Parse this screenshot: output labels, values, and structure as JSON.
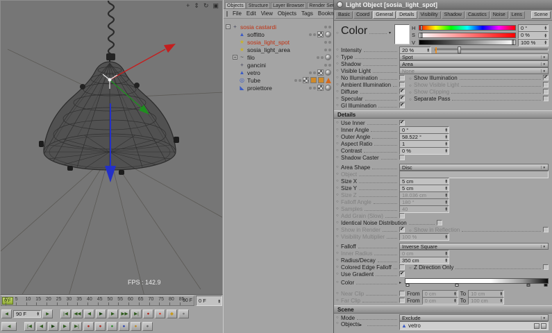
{
  "colors": {
    "ui_background": "#a6a6a6",
    "viewport_background": "#767676",
    "selection_red": "#c03010",
    "axis_x_red": "#c41e1e",
    "axis_y_green": "#1f8f1f",
    "axis_z_blue": "#2330c8",
    "timeline_green": "#93ad3a",
    "record_red": "#b02a1e"
  },
  "viewport": {
    "fps_label": "FPS : 142.9",
    "toolbar_icons": [
      "pan-icon",
      "zoom-icon",
      "rotate-icon",
      "maximize-icon"
    ]
  },
  "timeline": {
    "ticks": [
      "0",
      "5",
      "10",
      "15",
      "20",
      "25",
      "30",
      "35",
      "40",
      "45",
      "50",
      "55",
      "60",
      "65",
      "70",
      "75",
      "80",
      "85"
    ],
    "end_label": "90 F",
    "playhead_label": "0 F",
    "frame_field": "90 F",
    "current_field": "0 F",
    "transport_row1": [
      "goto-start",
      "prev-key",
      "prev-frame",
      "play",
      "next-frame",
      "next-key",
      "goto-end",
      "record",
      "record-active",
      "key",
      "autokey"
    ],
    "transport_row2": [
      "goto-start",
      "prev-frame",
      "play",
      "next-frame",
      "goto-end",
      "record",
      "record-position",
      "record-scale",
      "record-rotation",
      "record-parameter",
      "record-point-level"
    ]
  },
  "objects_panel": {
    "tabs": [
      "Objects",
      "Structure",
      "Layer Browser",
      "Render Settings"
    ],
    "active_tab": "Objects",
    "menu": [
      "File",
      "Edit",
      "View",
      "Objects",
      "Tags",
      "Bookmarks"
    ],
    "tree": [
      {
        "label": "sosia castardi",
        "level": 0,
        "icon": "null-icon",
        "expander": "-",
        "selected": true,
        "tags": []
      },
      {
        "label": "soffitto",
        "level": 1,
        "icon": "polygon-icon",
        "expander": "",
        "selected": false,
        "tags": [
          "texture-tag",
          "phong-tag"
        ]
      },
      {
        "label": "sosia_light_spot",
        "level": 1,
        "icon": "light-icon",
        "expander": "",
        "selected": true,
        "tags": []
      },
      {
        "label": "sosia_light_area",
        "level": 1,
        "icon": "light-icon",
        "expander": "",
        "selected": false,
        "tags": []
      },
      {
        "label": "filo",
        "level": 1,
        "icon": "spline-icon",
        "expander": "+",
        "selected": false,
        "tags": [
          "phong-tag"
        ]
      },
      {
        "label": "gancini",
        "level": 1,
        "icon": "null-icon",
        "expander": "",
        "selected": false,
        "tags": []
      },
      {
        "label": "vetro",
        "level": 1,
        "icon": "polygon-icon",
        "expander": "",
        "selected": false,
        "tags": [
          "texture-tag",
          "phong-tag"
        ]
      },
      {
        "label": "Tube",
        "level": 1,
        "icon": "tube-icon",
        "expander": "",
        "selected": false,
        "tags": [
          "texture-tag",
          "osq-tag",
          "osq-tag",
          "warning-tag"
        ]
      },
      {
        "label": "proiettore",
        "level": 1,
        "icon": "cone-icon",
        "expander": "",
        "selected": false,
        "tags": [
          "texture-tag",
          "phong-tag"
        ]
      }
    ]
  },
  "attributes": {
    "title": "Light Object [sosia_light_spot]",
    "tabs": [
      {
        "label": "Basic",
        "active": false
      },
      {
        "label": "Coord",
        "active": false
      },
      {
        "label": "General",
        "active": true
      },
      {
        "label": "Details",
        "active": true
      },
      {
        "label": "Visibility",
        "active": false
      },
      {
        "label": "Shadow",
        "active": false
      },
      {
        "label": "Caustics",
        "active": false
      },
      {
        "label": "Noise",
        "active": false
      },
      {
        "label": "Lens",
        "active": false
      },
      {
        "label": "Scene",
        "active": true
      }
    ],
    "general": {
      "color_label": "Color",
      "h_label": "H",
      "h_value": "0 °",
      "s_label": "S",
      "s_value": "0 %",
      "v_label": "V",
      "v_value": "100 %",
      "intensity_label": "Intensity",
      "intensity_value": "20 %",
      "type_label": "Type",
      "type_value": "Spot",
      "shadow_label": "Shadow",
      "shadow_value": "Area",
      "visible_light_label": "Visible Light",
      "visible_light_value": "None",
      "checks": [
        {
          "l": "No Illumination",
          "lc": false,
          "r": "Show Illumination",
          "rc": true
        },
        {
          "l": "Ambient Illumination",
          "lc": false,
          "r": "Show Visible Light",
          "rc": false
        },
        {
          "l": "Diffuse",
          "lc": true,
          "r": "Show Clipping",
          "rc": false
        },
        {
          "l": "Specular",
          "lc": true,
          "r": "Separate Pass",
          "rc": false
        }
      ],
      "gi_label": "GI Illumination",
      "gi_checked": true
    },
    "details": {
      "header": "Details",
      "use_inner_label": "Use Inner",
      "use_inner": true,
      "inner_angle_label": "Inner Angle",
      "inner_angle": "0 °",
      "outer_angle_label": "Outer Angle",
      "outer_angle": "58.522 °",
      "aspect_label": "Aspect Ratio",
      "aspect": "1",
      "contrast_label": "Contrast",
      "contrast": "0 %",
      "shadow_caster_label": "Shadow Caster",
      "shadow_caster": false,
      "area_shape_label": "Area Shape",
      "area_shape": "Disc",
      "object_label": "Object",
      "object_value": "",
      "size_x_label": "Size X",
      "size_x": "5 cm",
      "size_y_label": "Size Y",
      "size_y": "5 cm",
      "size_z_label": "Size Z",
      "size_z": "18.036 cm",
      "falloff_angle_label": "Falloff Angle",
      "falloff_angle": "180 °",
      "samples_label": "Samples",
      "samples": "40",
      "add_grain_label": "Add Grain (Slow)",
      "add_grain": false,
      "identical_noise_label": "Identical Noise Distribution",
      "identical_noise": false,
      "show_in_render_label": "Show in Render",
      "show_in_render": true,
      "show_in_reflection_label": "Show in Reflection",
      "show_in_reflection": false,
      "visibility_multiplier_label": "Visibility Multiplier",
      "visibility_multiplier": "100 %",
      "falloff_label": "Falloff",
      "falloff": "Inverse Square",
      "inner_radius_label": "Inner Radius",
      "inner_radius": "0 cm",
      "radius_decay_label": "Radius/Decay",
      "radius_decay": "350 cm",
      "colored_edge_label": "Colored Edge Falloff",
      "colored_edge": false,
      "z_direction_label": "Z Direction Only",
      "z_direction": false,
      "use_gradient_label": "Use Gradient",
      "use_gradient": true,
      "gradient_label": "Color",
      "near_clip_label": "Near Clip",
      "near_clip": false,
      "near_from_label": "From",
      "near_from": "0 cm",
      "near_to_label": "To",
      "near_to": "10 cm",
      "far_clip_label": "Far Clip",
      "far_clip": false,
      "far_from_label": "From",
      "far_from": "0 cm",
      "far_to_label": "To",
      "far_to": "100 cm"
    },
    "scene": {
      "header": "Scene",
      "mode_label": "Mode",
      "mode": "Exclude",
      "objects_label": "Objects",
      "objects": [
        {
          "label": "vetro",
          "icon": "polygon-icon"
        }
      ]
    }
  }
}
